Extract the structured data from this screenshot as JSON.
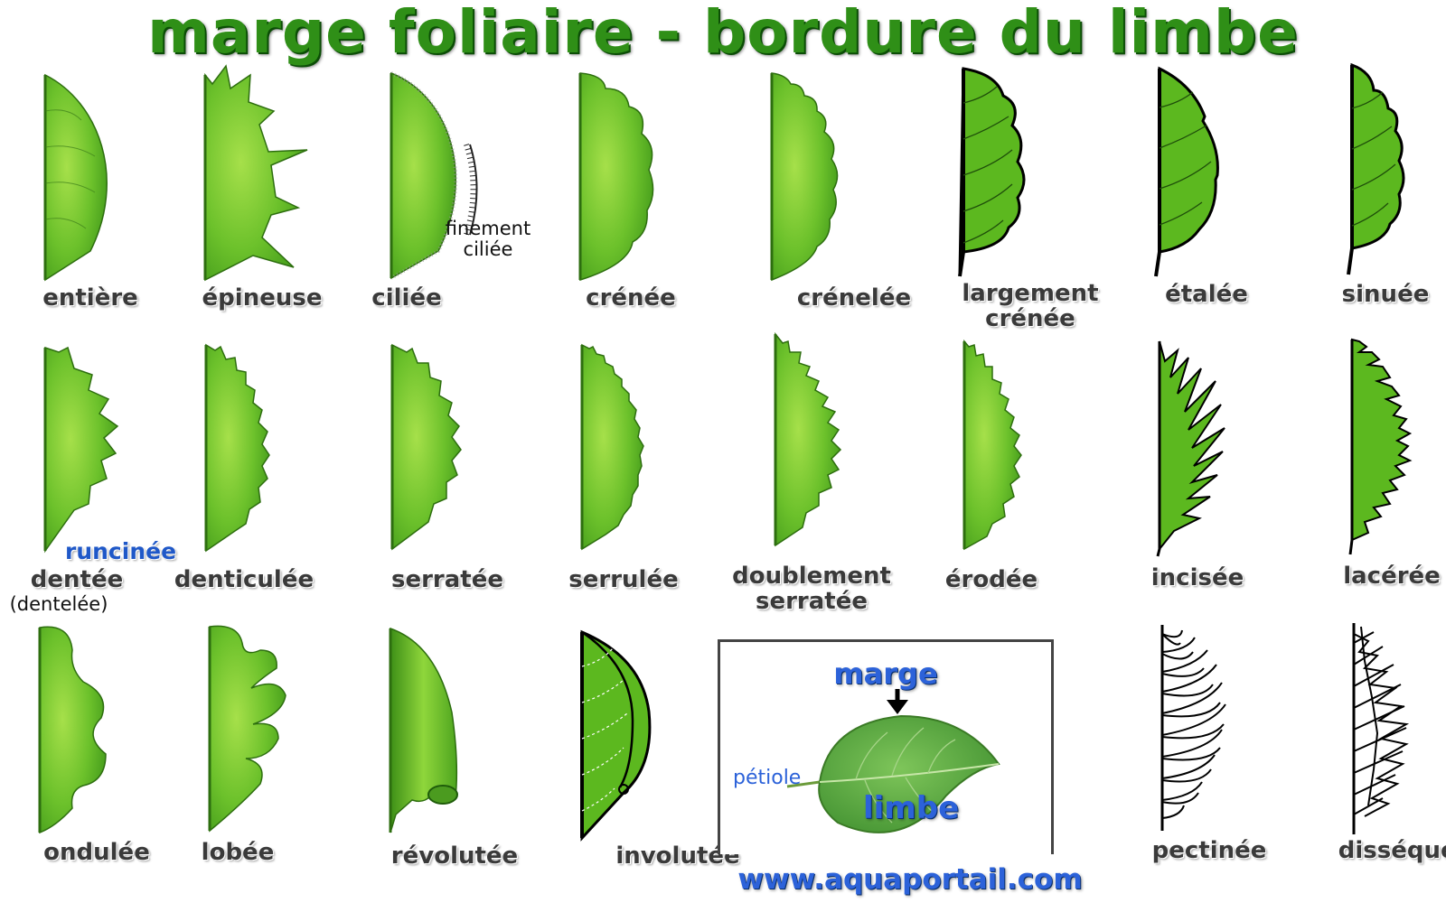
{
  "title": "marge foliaire - bordure du limbe",
  "colors": {
    "leaf_light": "#8ed436",
    "leaf_dark": "#3f9a1c",
    "leaf_flat": "#5cb81f",
    "title": "#2f8f17",
    "label_blue": "#2c62d9"
  },
  "labels": {
    "entiere": "entière",
    "epineuse": "épineuse",
    "ciliee": "ciliée",
    "crenee": "crénée",
    "crenelee": "crénelée",
    "largement_crenee_1": "largement",
    "largement_crenee_2": "crénée",
    "etalee": "étalée",
    "sinuee": "sinuée",
    "dentee": "dentée",
    "dentelee": "(dentelée)",
    "runcinee": "runcinée",
    "denticulee": "denticulée",
    "serratee": "serratée",
    "serrulee": "serrulée",
    "doublement_serratee_1": "doublement",
    "doublement_serratee_2": "serratée",
    "erodee": "érodée",
    "incisee": "incisée",
    "lacerée": "lacérée",
    "ondulee": "ondulée",
    "lobee": "lobée",
    "revolutee": "révolutée",
    "involutee": "involutée",
    "pectinee": "pectinée",
    "dissequee": "disséquée"
  },
  "notes": {
    "finement_1": "finement",
    "finement_2": "ciliée"
  },
  "inset": {
    "marge": "marge",
    "petiole": "pétiole",
    "limbe": "limbe"
  },
  "website": "www.aquaportail.com"
}
